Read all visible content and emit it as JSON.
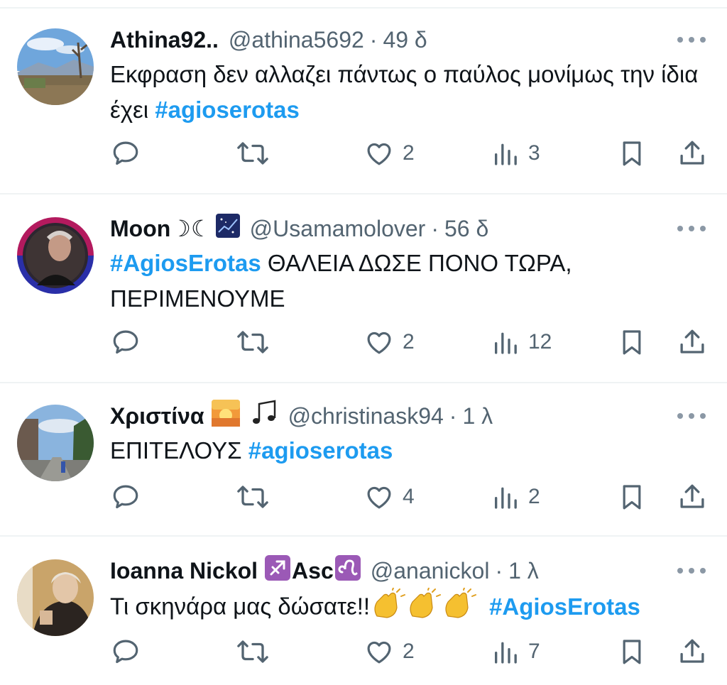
{
  "tweets": [
    {
      "name": "Athina92..",
      "handle": "@athina5692",
      "time": "49 δ",
      "text_before": "Εκφραση δεν αλλαζει πάντως ο παύλος μονίμως την ίδια έχει ",
      "hashtag": "#agioserotas",
      "text_after": "",
      "likes": "2",
      "views": "3",
      "avatar": "landscape-avatar"
    },
    {
      "name": "Moon☽☾",
      "name_emoji": "night-sky-emoji",
      "handle": "@Usamamolover",
      "time": "56 δ",
      "text_before": "",
      "hashtag": "#AgiosErotas",
      "text_after": " ΘΑΛΕΙΑ ΔΩΣΕ ΠΟΝΟ ΤΩΡΑ, ΠΕΡΙΜΕΝΟΥΜΕ",
      "likes": "2",
      "views": "12",
      "avatar": "man-portrait-avatar"
    },
    {
      "name": "Χριστίνα",
      "name_emoji": "sunrise-emoji musical-notes-emoji",
      "handle": "@christinask94",
      "time": "1 λ",
      "text_before": "ΕΠΙΤΕΛΟΥΣ ",
      "hashtag": "#agioserotas",
      "text_after": "",
      "likes": "4",
      "views": "2",
      "avatar": "street-avatar"
    },
    {
      "name": "Ioanna Nickol",
      "name_emoji": "sagittarius-emoji",
      "name_suffix": "Asc",
      "name_suffix_emoji": "leo-emoji",
      "handle": "@ananickol",
      "time": "1 λ",
      "text_before": "Τι σκηνάρα μας δώσατε!!",
      "text_emoji": "clapping-hands-emoji x3",
      "hashtag": "#AgiosErotas",
      "text_after": "",
      "likes": "2",
      "views": "7",
      "avatar": "woman-portrait-avatar"
    }
  ],
  "colors": {
    "hashtag": "#1d9bf0",
    "secondary_text": "#536471",
    "primary_text": "#0f1419",
    "separator": "#eff3f4"
  },
  "icons": [
    "reply-icon",
    "retweet-icon",
    "like-icon",
    "views-icon",
    "bookmark-icon",
    "share-icon",
    "more-icon"
  ]
}
